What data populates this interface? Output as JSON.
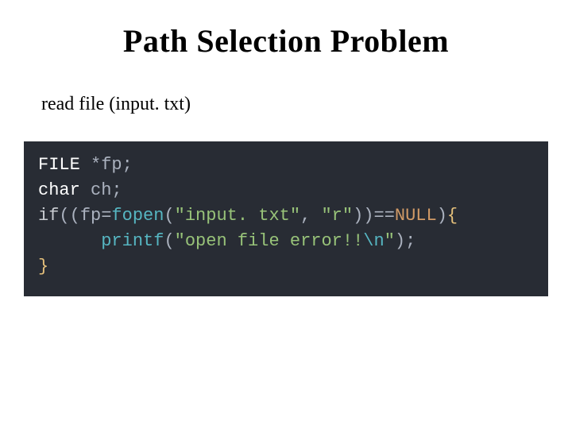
{
  "title": "Path Selection Problem",
  "subtitle": "read file (input. txt)",
  "code": {
    "l1": {
      "type": "FILE",
      "star": "*",
      "id": "fp",
      "semi": ";"
    },
    "l2": {
      "type": "char",
      "id": "ch",
      "semi": ";"
    },
    "l3": {
      "kw": "if",
      "p1": "((",
      "id1": "fp",
      "eq": "=",
      "func": "fopen",
      "p2": "(",
      "str1": "\"input. txt\"",
      "comma": ", ",
      "str2": "\"r\"",
      "p3": "))==",
      "null": "NULL",
      "p4": ")",
      "brace": "{"
    },
    "l4": {
      "indent": "      ",
      "func": "printf",
      "p1": "(",
      "str_a": "\"open file error!!",
      "esc": "\\n",
      "str_b": "\"",
      "p2": ");"
    },
    "l5": {
      "brace": "}"
    }
  }
}
